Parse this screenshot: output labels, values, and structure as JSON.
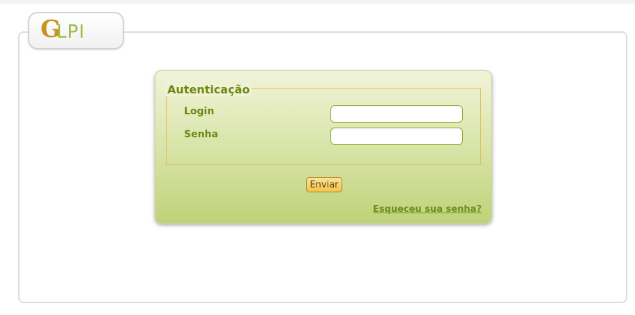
{
  "header": {
    "logo_mark": "G",
    "logo_text": "LPI"
  },
  "login": {
    "legend": "Autenticação",
    "login_label": "Login",
    "password_label": "Senha",
    "login_value": "",
    "password_value": "",
    "submit_label": "Enviar",
    "forgot_link": "Esqueceu sua senha?"
  },
  "colors": {
    "accent_green": "#6a8a12",
    "logo_gold": "#c7951f",
    "logo_green": "#9bbb3b",
    "button_gold": "#f4c44a",
    "fieldset_border": "#e6b850"
  }
}
